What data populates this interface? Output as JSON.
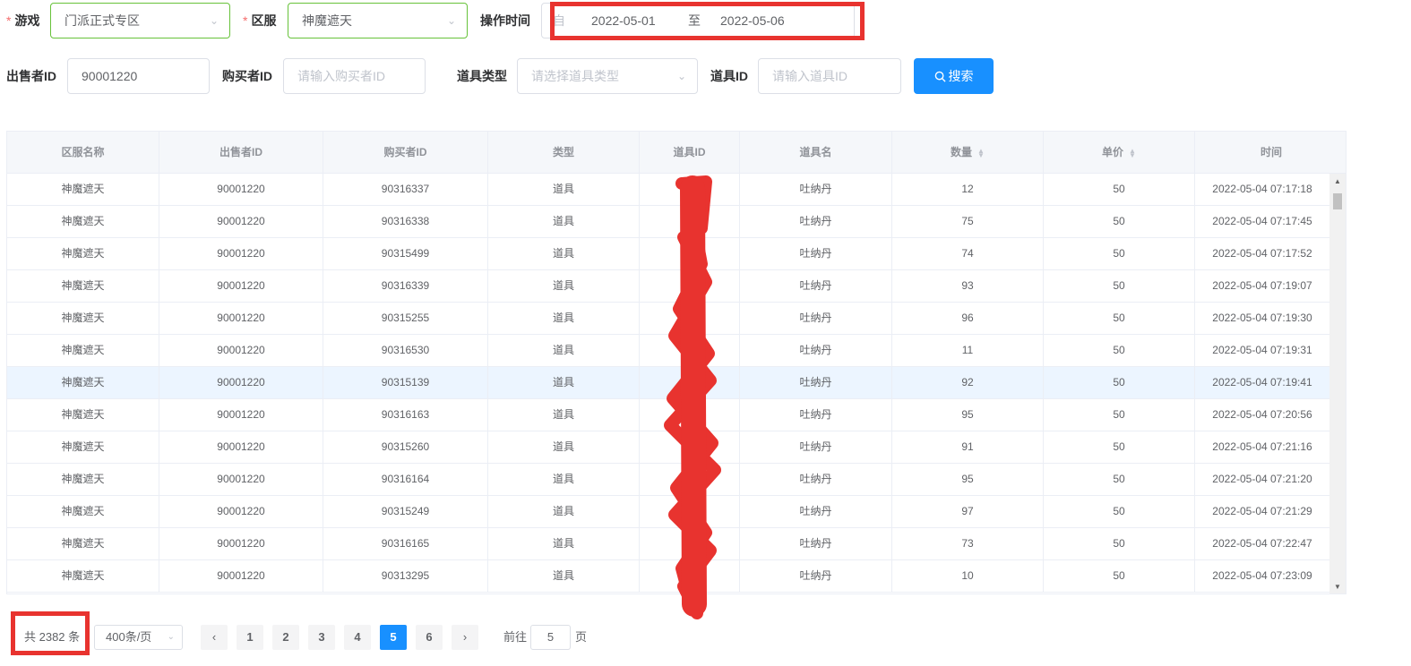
{
  "filters": {
    "game_label": "游戏",
    "game_value": "门派正式专区",
    "server_label": "区服",
    "server_value": "神魔遮天",
    "time_label": "操作时间",
    "time_prefix": "自",
    "date_start": "2022-05-01",
    "date_sep": "至",
    "date_end": "2022-05-06",
    "seller_label": "出售者ID",
    "seller_value": "90001220",
    "buyer_label": "购买者ID",
    "buyer_placeholder": "请输入购买者ID",
    "item_type_label": "道具类型",
    "item_type_placeholder": "请选择道具类型",
    "item_id_label": "道具ID",
    "item_id_placeholder": "请输入道具ID",
    "search_label": "搜索",
    "required_mark": "*"
  },
  "table": {
    "columns": [
      "区服名称",
      "出售者ID",
      "购买者ID",
      "类型",
      "道具ID",
      "道具名",
      "数量",
      "单价",
      "时间"
    ],
    "rows": [
      [
        "神魔遮天",
        "90001220",
        "90316337",
        "道具",
        "",
        "吐纳丹",
        "12",
        "50",
        "2022-05-04 07:17:18"
      ],
      [
        "神魔遮天",
        "90001220",
        "90316338",
        "道具",
        "",
        "吐纳丹",
        "75",
        "50",
        "2022-05-04 07:17:45"
      ],
      [
        "神魔遮天",
        "90001220",
        "90315499",
        "道具",
        "",
        "吐纳丹",
        "74",
        "50",
        "2022-05-04 07:17:52"
      ],
      [
        "神魔遮天",
        "90001220",
        "90316339",
        "道具",
        "",
        "吐纳丹",
        "93",
        "50",
        "2022-05-04 07:19:07"
      ],
      [
        "神魔遮天",
        "90001220",
        "90315255",
        "道具",
        "",
        "吐纳丹",
        "96",
        "50",
        "2022-05-04 07:19:30"
      ],
      [
        "神魔遮天",
        "90001220",
        "90316530",
        "道具",
        "",
        "吐纳丹",
        "11",
        "50",
        "2022-05-04 07:19:31"
      ],
      [
        "神魔遮天",
        "90001220",
        "90315139",
        "道具",
        "",
        "吐纳丹",
        "92",
        "50",
        "2022-05-04 07:19:41"
      ],
      [
        "神魔遮天",
        "90001220",
        "90316163",
        "道具",
        "",
        "吐纳丹",
        "95",
        "50",
        "2022-05-04 07:20:56"
      ],
      [
        "神魔遮天",
        "90001220",
        "90315260",
        "道具",
        "",
        "吐纳丹",
        "91",
        "50",
        "2022-05-04 07:21:16"
      ],
      [
        "神魔遮天",
        "90001220",
        "90316164",
        "道具",
        "",
        "吐纳丹",
        "95",
        "50",
        "2022-05-04 07:21:20"
      ],
      [
        "神魔遮天",
        "90001220",
        "90315249",
        "道具",
        "",
        "吐纳丹",
        "97",
        "50",
        "2022-05-04 07:21:29"
      ],
      [
        "神魔遮天",
        "90001220",
        "90316165",
        "道具",
        "",
        "吐纳丹",
        "73",
        "50",
        "2022-05-04 07:22:47"
      ],
      [
        "神魔遮天",
        "90001220",
        "90313295",
        "道具",
        "",
        "吐纳丹",
        "10",
        "50",
        "2022-05-04 07:23:09"
      ]
    ],
    "highlighted_row": 6
  },
  "pagination": {
    "total_text": "共 2382 条",
    "page_size": "400条/页",
    "pages": [
      "1",
      "2",
      "3",
      "4",
      "5",
      "6"
    ],
    "current_page": "5",
    "goto_prefix": "前往",
    "goto_value": "5",
    "goto_suffix": "页"
  },
  "colors": {
    "primary": "#1890ff",
    "success_border": "#67c23a",
    "annotation_red": "#e8332f"
  }
}
